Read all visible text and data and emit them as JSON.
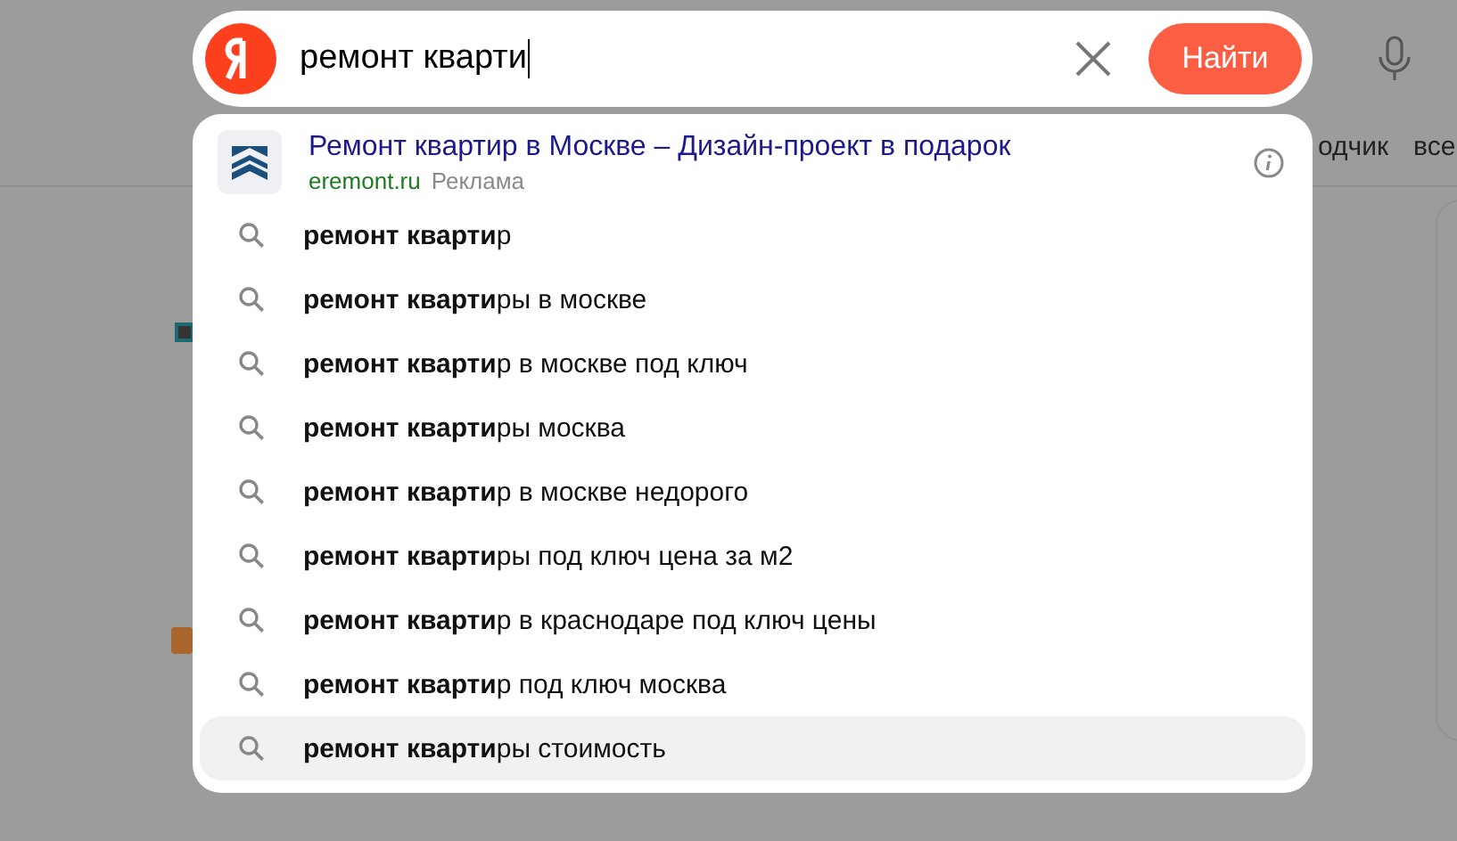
{
  "search": {
    "value": "ремонт кварти",
    "button": "Найти"
  },
  "background_tabs": [
    "одчик",
    "все"
  ],
  "ad": {
    "title": "Ремонт квартир в Москве – Дизайн-проект в подарок",
    "domain": "eremont.ru",
    "label": "Реклама"
  },
  "suggestions": [
    {
      "text": "**ремонт кварти**р",
      "selected": false
    },
    {
      "text": "**ремонт кварти**ры в москве",
      "selected": false
    },
    {
      "text": "**ремонт кварти**р в москве под ключ",
      "selected": false
    },
    {
      "text": "**ремонт кварти**ры москва",
      "selected": false
    },
    {
      "text": "**ремонт кварти**р в москве недорого",
      "selected": false
    },
    {
      "text": "**ремонт кварти**ры под ключ цена за м2",
      "selected": false
    },
    {
      "text": "**ремонт кварти**р в краснодаре под ключ цены",
      "selected": false
    },
    {
      "text": "**ремонт кварти**р под ключ москва",
      "selected": false
    },
    {
      "text": "**ремонт кварти**ры стоимость",
      "selected": true
    }
  ]
}
